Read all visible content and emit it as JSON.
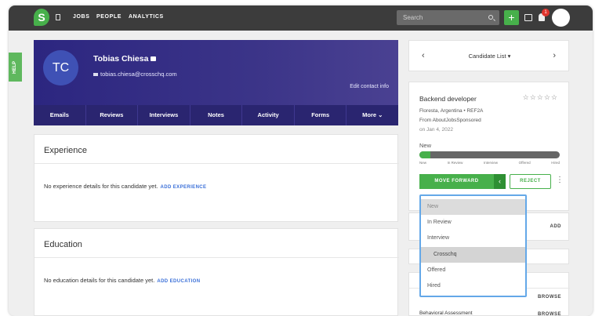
{
  "topbar": {
    "logo": "S",
    "nav": [
      "JOBS",
      "PEOPLE",
      "ANALYTICS"
    ],
    "search_placeholder": "Search",
    "add": "+",
    "notifications": "1"
  },
  "help": "HELP",
  "profile": {
    "initials": "TC",
    "name": "Tobias Chiesa",
    "email": "tobias.chiesa@crosschq.com",
    "edit_contact": "Edit contact info",
    "tabs": [
      "Emails",
      "Reviews",
      "Interviews",
      "Notes",
      "Activity",
      "Forms",
      "More ⌄"
    ]
  },
  "experience": {
    "title": "Experience",
    "empty": "No experience details for this candidate yet.",
    "add": "ADD EXPERIENCE"
  },
  "education": {
    "title": "Education",
    "empty": "No education details for this candidate yet.",
    "add": "ADD EDUCATION"
  },
  "candidate_list": {
    "label": "Candidate List ▾",
    "prev": "‹",
    "next": "›"
  },
  "job": {
    "title": "Backend developer",
    "stars": "☆☆☆☆☆",
    "location": "Floresta, Argentina  •  REF2A",
    "source": "From AboutJobsSponsored",
    "date": "on Jan 4, 2022",
    "stage": "New",
    "progress": 0.08,
    "steps": [
      "New",
      "In Review",
      "Interview",
      "Offered",
      "Hired"
    ],
    "move_forward": "MOVE FORWARD",
    "reject": "REJECT"
  },
  "dropdown": {
    "options": [
      "New",
      "In Review",
      "Interview",
      "Crosschq",
      "Offered",
      "Hired"
    ],
    "selected": "New",
    "hovered": "Crosschq"
  },
  "side": {
    "add": "ADD",
    "browse": "BROWSE",
    "behavioral": "Behavioral Assessment"
  }
}
